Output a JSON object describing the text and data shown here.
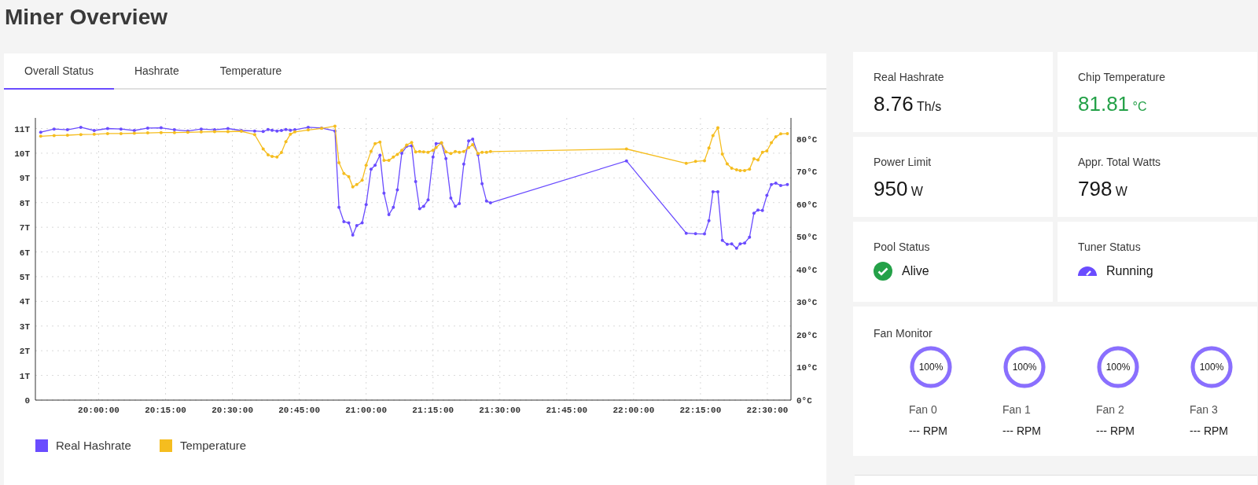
{
  "page_title": "Miner Overview",
  "tabs": [
    {
      "label": "Overall Status",
      "selected": true
    },
    {
      "label": "Hashrate",
      "selected": false
    },
    {
      "label": "Temperature",
      "selected": false
    }
  ],
  "chart_data": {
    "type": "line",
    "grid": true,
    "x": [
      71220,
      71400,
      71580,
      71760,
      71940,
      72120,
      72300,
      72480,
      72660,
      72840,
      73020,
      73200,
      73380,
      73560,
      73740,
      73920,
      74100,
      74214,
      74280,
      74334,
      74400,
      74460,
      74520,
      74580,
      74640,
      74820,
      75000,
      75180,
      75234,
      75300,
      75366,
      75420,
      75474,
      75546,
      75600,
      75666,
      75720,
      75786,
      75840,
      75906,
      75966,
      76020,
      76080,
      76146,
      76212,
      76266,
      76320,
      76374,
      76434,
      76500,
      76542,
      76614,
      76674,
      76740,
      76800,
      76854,
      76914,
      76980,
      77034,
      77106,
      77160,
      77220,
      77274,
      79104,
      79908,
      80034,
      80154,
      80214,
      80268,
      80334,
      80394,
      80460,
      80520,
      80586,
      80634,
      80694,
      80760,
      80820,
      80874,
      80934,
      80994,
      81054,
      81114,
      81180,
      81270
    ],
    "series": [
      {
        "name": "Real Hashrate",
        "color": "#6a4cff",
        "values": [
          10.85,
          10.98,
          10.95,
          11.05,
          10.92,
          11.0,
          10.98,
          10.92,
          11.02,
          11.03,
          10.95,
          10.9,
          10.98,
          10.95,
          11.0,
          10.92,
          10.9,
          10.88,
          10.96,
          10.93,
          10.9,
          10.92,
          10.96,
          10.93,
          10.95,
          11.05,
          11.02,
          10.9,
          7.81,
          7.23,
          7.18,
          6.69,
          7.07,
          7.18,
          7.92,
          9.35,
          9.51,
          9.92,
          8.38,
          7.51,
          7.81,
          8.52,
          10.0,
          10.28,
          10.3,
          8.85,
          7.75,
          7.85,
          8.11,
          9.85,
          10.39,
          10.41,
          9.78,
          8.18,
          7.85,
          7.96,
          9.56,
          10.5,
          10.57,
          9.94,
          8.76,
          8.06,
          7.99,
          9.69,
          6.76,
          6.74,
          6.73,
          7.27,
          8.44,
          8.44,
          6.47,
          6.31,
          6.33,
          6.15,
          6.33,
          6.36,
          6.6,
          7.57,
          7.7,
          7.68,
          8.29,
          8.73,
          8.79,
          8.69,
          8.73
        ]
      },
      {
        "name": "Temperature",
        "color": "#f5bd1f",
        "axis": "y2",
        "values": [
          80.8,
          81.0,
          81.1,
          81.3,
          81.4,
          81.6,
          81.6,
          81.7,
          81.8,
          81.9,
          81.9,
          82.0,
          82.1,
          82.2,
          82.2,
          82.3,
          81.3,
          76.9,
          75.1,
          74.6,
          74.4,
          75.8,
          79.1,
          81.4,
          82.1,
          82.7,
          83.2,
          83.9,
          72.7,
          69.4,
          68.4,
          65.3,
          66.0,
          67.3,
          71.9,
          76.2,
          78.5,
          79.0,
          73.4,
          73.4,
          74.4,
          75.2,
          76.5,
          78.1,
          78.9,
          76.0,
          76.1,
          76.0,
          75.9,
          76.5,
          77.3,
          78.8,
          76.0,
          75.5,
          76.1,
          75.9,
          76.1,
          77.3,
          78.2,
          75.5,
          75.9,
          75.9,
          76.1,
          76.9,
          72.5,
          73.1,
          73.3,
          77.2,
          81.0,
          83.4,
          75.3,
          72.3,
          71.0,
          70.5,
          70.3,
          70.3,
          70.7,
          73.9,
          73.5,
          75.9,
          76.3,
          78.8,
          80.6,
          81.5,
          81.6
        ]
      }
    ],
    "xlim": [
      71148,
      81318
    ],
    "ylim": [
      0,
      11.43
    ],
    "y2lim": [
      0,
      86.4
    ],
    "xticks": [
      {
        "value": 72000,
        "label": "20:00:00"
      },
      {
        "value": 72900,
        "label": "20:15:00"
      },
      {
        "value": 73800,
        "label": "20:30:00"
      },
      {
        "value": 74700,
        "label": "20:45:00"
      },
      {
        "value": 75600,
        "label": "21:00:00"
      },
      {
        "value": 76500,
        "label": "21:15:00"
      },
      {
        "value": 77400,
        "label": "21:30:00"
      },
      {
        "value": 78300,
        "label": "21:45:00"
      },
      {
        "value": 79200,
        "label": "22:00:00"
      },
      {
        "value": 80100,
        "label": "22:15:00"
      },
      {
        "value": 81000,
        "label": "22:30:00"
      }
    ],
    "yticks": [
      {
        "value": 0,
        "label": "0"
      },
      {
        "value": 1,
        "label": "1T"
      },
      {
        "value": 2,
        "label": "2T"
      },
      {
        "value": 3,
        "label": "3T"
      },
      {
        "value": 4,
        "label": "4T"
      },
      {
        "value": 5,
        "label": "5T"
      },
      {
        "value": 6,
        "label": "6T"
      },
      {
        "value": 7,
        "label": "7T"
      },
      {
        "value": 8,
        "label": "8T"
      },
      {
        "value": 9,
        "label": "9T"
      },
      {
        "value": 10,
        "label": "10T"
      },
      {
        "value": 11,
        "label": "11T"
      }
    ],
    "y2ticks": [
      {
        "value": 0,
        "label": "0°C"
      },
      {
        "value": 10,
        "label": "10°C"
      },
      {
        "value": 20,
        "label": "20°C"
      },
      {
        "value": 30,
        "label": "30°C"
      },
      {
        "value": 40,
        "label": "40°C"
      },
      {
        "value": 50,
        "label": "50°C"
      },
      {
        "value": 60,
        "label": "60°C"
      },
      {
        "value": 70,
        "label": "70°C"
      },
      {
        "value": 80,
        "label": "80°C"
      }
    ]
  },
  "stats": [
    {
      "kind": "metric",
      "label": "Real Hashrate",
      "value": "8.76",
      "unit": "Th/s",
      "color": "#161616"
    },
    {
      "kind": "metric",
      "label": "Chip Temperature",
      "value": "81.81",
      "unit": "°C",
      "color": "#24a148"
    },
    {
      "kind": "metric",
      "label": "Power Limit",
      "value": "950",
      "unit": "W",
      "color": "#161616"
    },
    {
      "kind": "metric",
      "label": "Appr. Total Watts",
      "value": "798",
      "unit": "W",
      "color": "#161616"
    },
    {
      "kind": "pool_status",
      "label": "Pool Status",
      "value": "Alive"
    },
    {
      "kind": "tuner_status",
      "label": "Tuner Status",
      "value": "Running"
    }
  ],
  "fan_monitor": {
    "title": "Fan Monitor",
    "fans": [
      {
        "reading": "100%",
        "level": 1,
        "name": "Fan 0",
        "speed": "--- RPM"
      },
      {
        "reading": "100%",
        "level": 1,
        "name": "Fan 1",
        "speed": "--- RPM"
      },
      {
        "reading": "100%",
        "level": 1,
        "name": "Fan 2",
        "speed": "--- RPM"
      },
      {
        "reading": "100%",
        "level": 1,
        "name": "Fan 3",
        "speed": "--- RPM"
      }
    ]
  }
}
